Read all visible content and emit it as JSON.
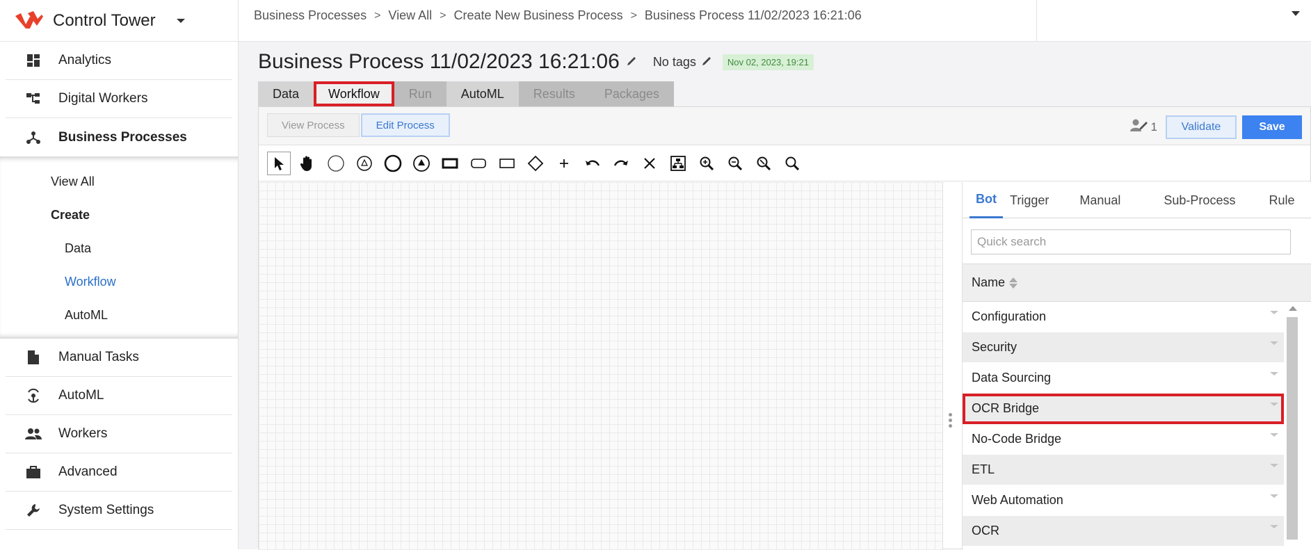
{
  "brand": {
    "title": "Control Tower",
    "logo_color": "#e8402a"
  },
  "sidebar": {
    "items_top": [
      {
        "label": "Analytics",
        "icon": "dashboard-icon"
      },
      {
        "label": "Digital Workers",
        "icon": "digital-workers-icon"
      },
      {
        "label": "Business Processes",
        "icon": "process-tree-icon",
        "active": true
      }
    ],
    "subnav": {
      "view_all": "View All",
      "create": "Create",
      "data": "Data",
      "workflow": "Workflow",
      "automl": "AutoML"
    },
    "items_bottom": [
      {
        "label": "Manual Tasks",
        "icon": "document-icon"
      },
      {
        "label": "AutoML",
        "icon": "automl-icon"
      },
      {
        "label": "Workers",
        "icon": "people-icon"
      },
      {
        "label": "Advanced",
        "icon": "briefcase-icon"
      },
      {
        "label": "System Settings",
        "icon": "wrench-icon"
      }
    ]
  },
  "breadcrumb": [
    "Business Processes",
    "View All",
    "Create New Business Process",
    "Business Process 11/02/2023 16:21:06"
  ],
  "page": {
    "title": "Business Process 11/02/2023 16:21:06",
    "tags": "No tags",
    "date_badge": "Nov 02, 2023, 19:21"
  },
  "tabs": [
    {
      "label": "Data",
      "state": "enabled"
    },
    {
      "label": "Workflow",
      "state": "active"
    },
    {
      "label": "Run",
      "state": "disabled"
    },
    {
      "label": "AutoML",
      "state": "enabled"
    },
    {
      "label": "Results",
      "state": "disabled"
    },
    {
      "label": "Packages",
      "state": "disabled"
    }
  ],
  "mode": {
    "view": "View Process",
    "edit": "Edit Process"
  },
  "collaborators": "1",
  "actions": {
    "validate": "Validate",
    "save": "Save"
  },
  "palette": {
    "tabs": [
      "Bot",
      "Trigger",
      "Manual",
      "Sub-Process",
      "Rule"
    ],
    "search_placeholder": "Quick search",
    "column_header": "Name",
    "rows": [
      "Configuration",
      "Security",
      "Data Sourcing",
      "OCR Bridge",
      "No-Code Bridge",
      "ETL",
      "Web Automation",
      "OCR"
    ]
  },
  "colors": {
    "accent": "#3a78d0",
    "highlight": "#d81f26",
    "save": "#3c82f0"
  }
}
